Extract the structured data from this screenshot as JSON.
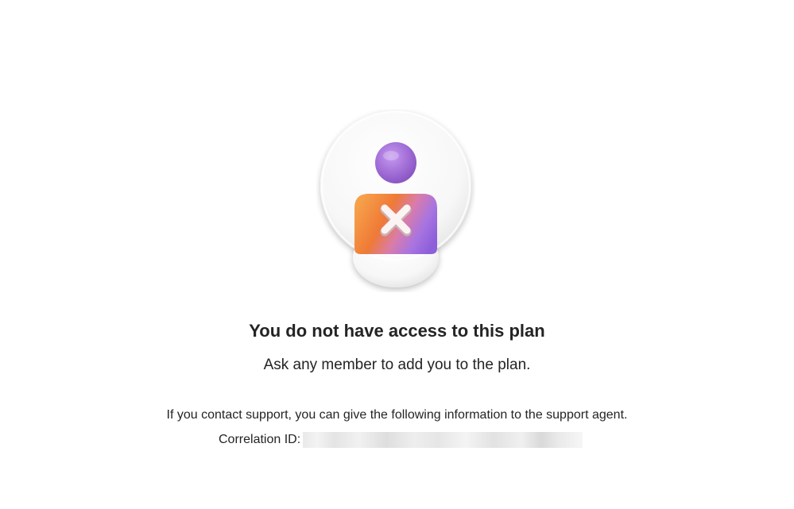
{
  "error": {
    "title": "You do not have access to this plan",
    "subtitle": "Ask any member to add you to the plan.",
    "support_text": "If you contact support, you can give the following information to the support agent.",
    "correlation_label": "Correlation ID:",
    "correlation_value": ""
  },
  "illustration": {
    "icon": "user-blocked-icon",
    "colors": {
      "head": "#a36fd8",
      "body_orange": "#f07a35",
      "body_purple": "#9b6be0",
      "x_mark": "#f5eeee"
    }
  }
}
